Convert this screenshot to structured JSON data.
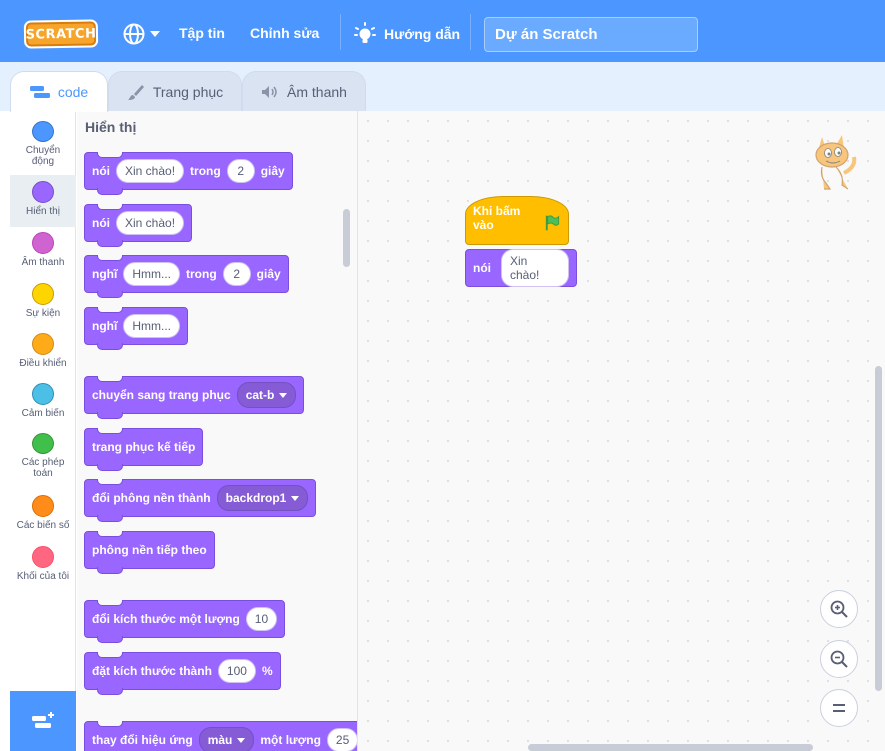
{
  "menubar": {
    "logo_text": "SCRATCH",
    "file_label": "Tập tin",
    "edit_label": "Chỉnh sửa",
    "tutorials_label": "Hướng dẫn",
    "project_title": "Dự án Scratch",
    "accent_color": "#4c97ff"
  },
  "tabs": [
    {
      "label": "code",
      "icon": "code-icon",
      "active": true
    },
    {
      "label": "Trang phục",
      "icon": "brush-icon",
      "active": false
    },
    {
      "label": "Âm thanh",
      "icon": "speaker-icon",
      "active": false
    }
  ],
  "categories": [
    {
      "label": "Chuyển động",
      "color": "#4c97ff"
    },
    {
      "label": "Hiển thị",
      "color": "#9966ff",
      "selected": true
    },
    {
      "label": "Âm thanh",
      "color": "#cf63cf"
    },
    {
      "label": "Sự kiện",
      "color": "#ffd500"
    },
    {
      "label": "Điều khiển",
      "color": "#ffab19"
    },
    {
      "label": "Cảm biến",
      "color": "#4cbfe6"
    },
    {
      "label": "Các phép toán",
      "color": "#40bf4a"
    },
    {
      "label": "Các biến số",
      "color": "#ff8c1a"
    },
    {
      "label": "Khối của tôi",
      "color": "#ff6680"
    }
  ],
  "palette": {
    "heading": "Hiển thị",
    "blocks": {
      "say_for": {
        "a": "nói",
        "msg": "Xin chào!",
        "b": "trong",
        "secs": "2",
        "c": "giây"
      },
      "say": {
        "a": "nói",
        "msg": "Xin chào!"
      },
      "think_for": {
        "a": "nghĩ",
        "msg": "Hmm...",
        "b": "trong",
        "secs": "2",
        "c": "giây"
      },
      "think": {
        "a": "nghĩ",
        "msg": "Hmm..."
      },
      "switch_costume": {
        "a": "chuyển sang trang phục",
        "opt": "cat-b"
      },
      "next_costume": {
        "a": "trang phục kế tiếp"
      },
      "switch_backdrop": {
        "a": "đổi phông nền thành",
        "opt": "backdrop1"
      },
      "next_backdrop": {
        "a": "phông nền tiếp theo"
      },
      "change_size": {
        "a": "đổi kích thước một lượng",
        "val": "10"
      },
      "set_size": {
        "a": "đặt kích thước thành",
        "val": "100",
        "unit": "%"
      },
      "change_effect": {
        "a": "thay đổi hiệu ứng",
        "opt": "màu",
        "b": "một lượng",
        "val": "25"
      }
    }
  },
  "script": {
    "hat_label": "Khi bấm vào",
    "say_label": "nói",
    "say_msg": "Xin chào!"
  },
  "icons": {
    "flag_color": "#4cbf56",
    "zoom_in": "zoom-in-icon",
    "zoom_out": "zoom-out-icon",
    "zoom_reset": "zoom-reset-icon"
  }
}
